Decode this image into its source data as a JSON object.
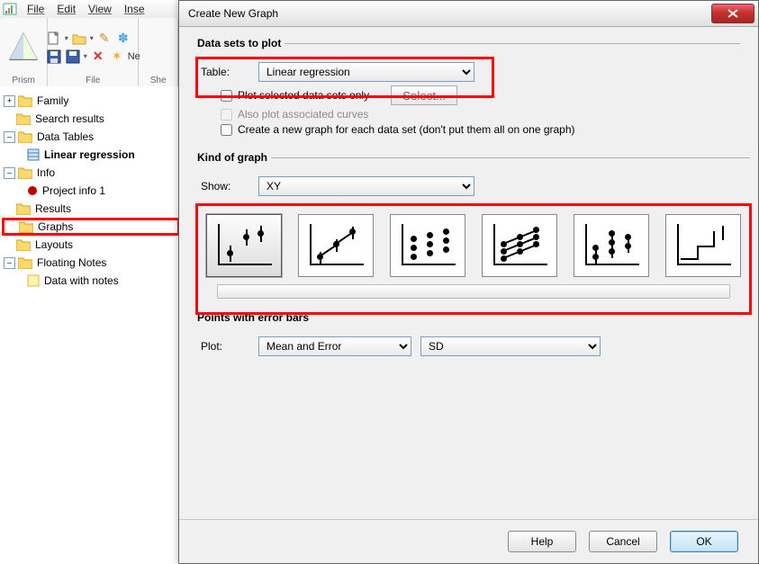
{
  "menu": {
    "file": "File",
    "edit": "Edit",
    "view": "View",
    "insert": "Inse"
  },
  "ribbon": {
    "groups": {
      "prism": "Prism",
      "file": "File",
      "sheet": "She"
    },
    "new_tip": "Ne"
  },
  "tree": {
    "family": "Family",
    "search": "Search results",
    "data_tables": "Data Tables",
    "linreg": "Linear regression",
    "info": "Info",
    "project_info": "Project info 1",
    "results": "Results",
    "graphs": "Graphs",
    "layouts": "Layouts",
    "floating": "Floating Notes",
    "data_notes": "Data with notes"
  },
  "dialog": {
    "title": "Create New Graph",
    "sections": {
      "datasets": "Data sets to plot",
      "kind": "Kind of graph",
      "points": "Points with error bars"
    },
    "labels": {
      "table": "Table:",
      "show": "Show:",
      "plot": "Plot:"
    },
    "table_sel": "Linear regression",
    "plot_selected": "Plot selected data sets only",
    "select_btn": "Select...",
    "also_assoc": "Also plot associated curves",
    "new_each": "Create a new graph for each data set (don't put them all on one graph)",
    "show_sel": "XY",
    "plot_sel": "Mean and Error",
    "err_sel": "SD",
    "buttons": {
      "help": "Help",
      "cancel": "Cancel",
      "ok": "OK"
    }
  }
}
